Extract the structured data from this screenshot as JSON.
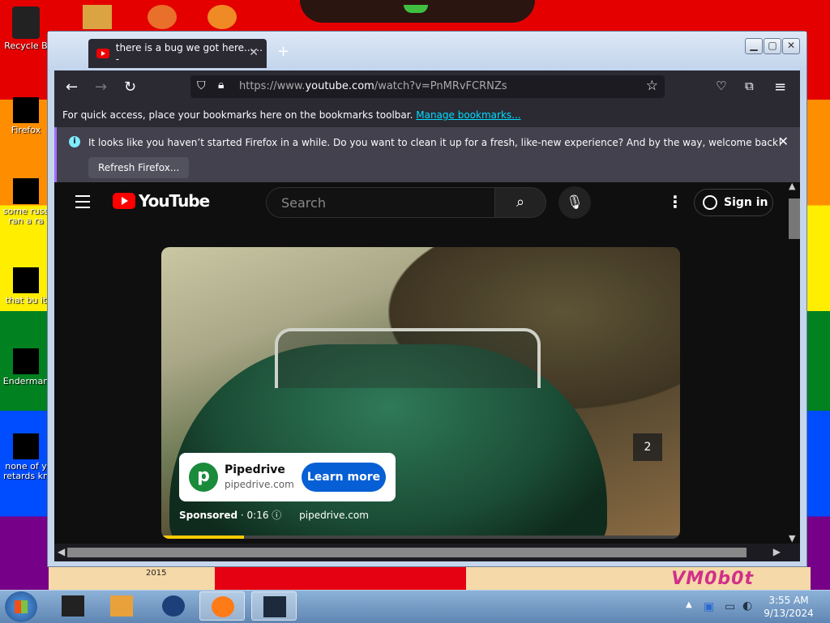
{
  "desktop": {
    "icons": [
      {
        "label": "Recycle B"
      },
      {
        "label": "Firefox"
      },
      {
        "label": "some russ ran a ra"
      },
      {
        "label": "that bu it"
      },
      {
        "label": "Enderman"
      },
      {
        "label": "none of y retards kn"
      }
    ],
    "bottom_text": "2015",
    "watermark": "VM0b0t"
  },
  "browser": {
    "tab_title": "there is a bug we got here...... -",
    "url_prefix": "https://www.",
    "url_host": "youtube.com",
    "url_path": "/watch?v=PnMRvFCRNZs",
    "bookmarks_text": "For quick access, place your bookmarks here on the bookmarks toolbar.",
    "bookmarks_link": "Manage bookmarks...",
    "notice_text": "It looks like you haven’t started Firefox in a while. Do you want to clean it up for a fresh, like-new experience? And by the way, welcome back!",
    "refresh_label": "Refresh Firefox..."
  },
  "youtube": {
    "logo_text": "YouTube",
    "search_placeholder": "Search",
    "signin_label": "Sign in",
    "ad": {
      "skip_count": "2",
      "advertiser": "Pipedrive",
      "domain": "pipedrive.com",
      "cta": "Learn more",
      "sponsored": "Sponsored",
      "duration": "· 0:16",
      "site": "pipedrive.com",
      "progress": 0.16
    }
  },
  "taskbar": {
    "time": "3:55 AM",
    "date": "9/13/2024"
  }
}
